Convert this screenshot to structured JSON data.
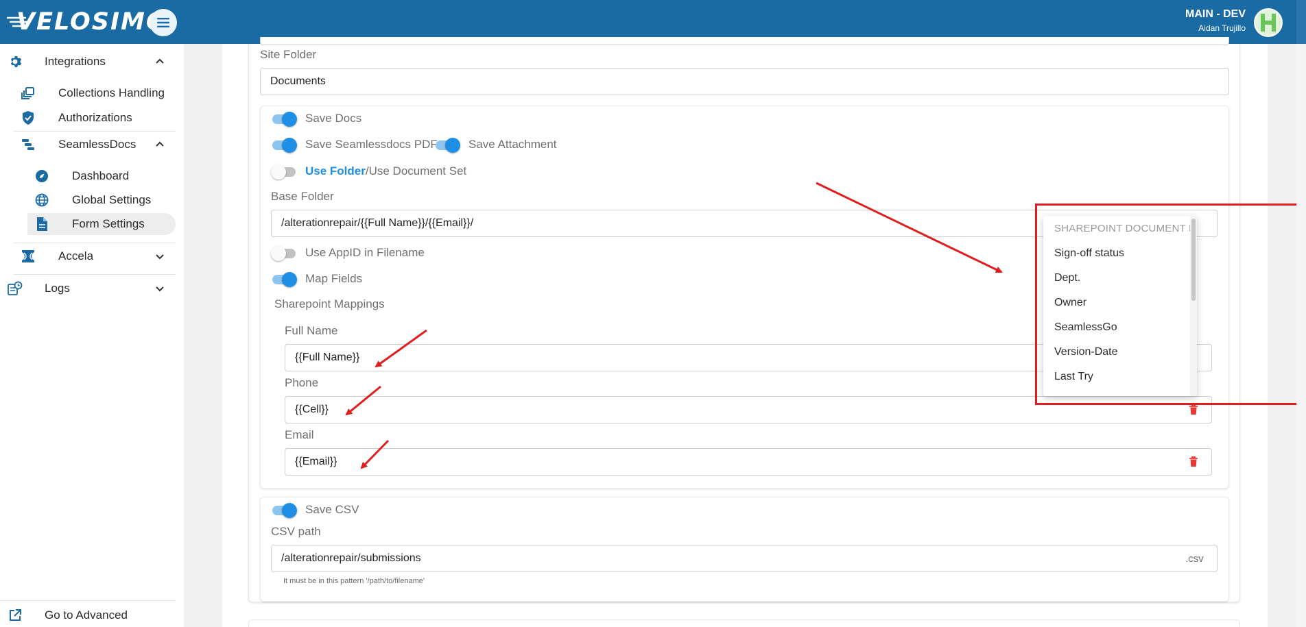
{
  "header": {
    "logo": "VELOSIMO",
    "env_title": "MAIN - DEV",
    "user_name": "Aidan Trujillo",
    "menu_icon": "hamburger-icon",
    "bar_color": "#1a6aa3"
  },
  "sidebar": {
    "integrations": "Integrations",
    "collections_handling": "Collections Handling",
    "authorizations": "Authorizations",
    "seamlessdocs": "SeamlessDocs",
    "dashboard": "Dashboard",
    "global_settings": "Global Settings",
    "form_settings": "Form Settings",
    "accela": "Accela",
    "logs": "Logs",
    "go_advanced": "Go to Advanced"
  },
  "form": {
    "site_folder_label": "Site Folder",
    "site_folder_value": "Documents",
    "save_docs": "Save Docs",
    "save_seamless_pdf": "Save Seamlessdocs PDF",
    "save_attachment": "Save Attachment",
    "use_folder": "Use Folder",
    "use_docset": "/Use Document Set",
    "base_folder_label": "Base Folder",
    "base_folder_value": "/alterationrepair/{{Full Name}}/{{Email}}/",
    "use_appid": "Use AppID in Filename",
    "map_fields": "Map Fields",
    "sharepoint_mappings": "Sharepoint Mappings",
    "mappings": [
      {
        "label": "Full Name",
        "value": "{{Full Name}}"
      },
      {
        "label": "Phone",
        "value": "{{Cell}}"
      },
      {
        "label": "Email",
        "value": "{{Email}}"
      }
    ],
    "save_csv": "Save CSV",
    "csv_path_label": "CSV path",
    "csv_path_value": "/alterationrepair/submissions",
    "csv_suffix": ".csv",
    "csv_helper": "It must be in this pattern '/path/to/filename'",
    "toggles": {
      "save_docs": true,
      "save_seamless_pdf": true,
      "save_attachment": true,
      "use_folder": false,
      "use_appid": false,
      "map_fields": true,
      "save_csv": true
    }
  },
  "dropdown": {
    "header": "SHAREPOINT DOCUMENT LIBRARY COLUMNS",
    "items": [
      "Sign-off status",
      "Dept.",
      "Owner",
      "SeamlessGo",
      "Version-Date",
      "Last Try"
    ]
  },
  "colors": {
    "accent": "#1f8fe5",
    "annotation": "#e01e1e",
    "delete": "#e53935"
  }
}
